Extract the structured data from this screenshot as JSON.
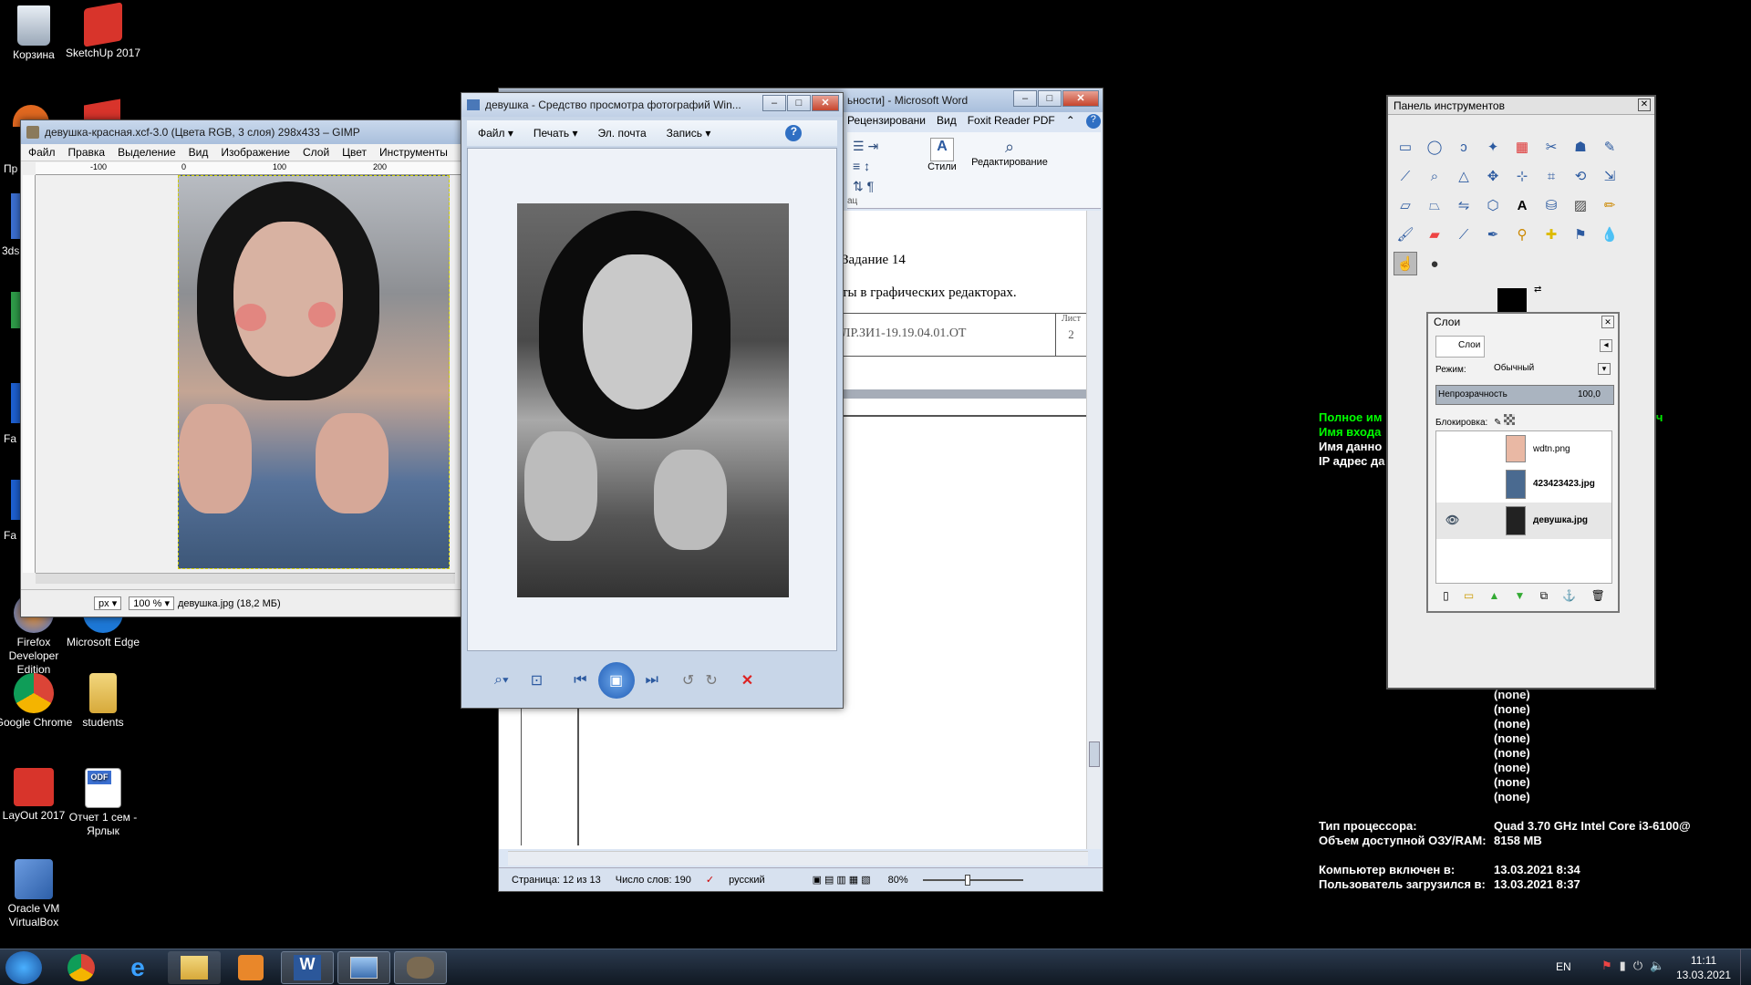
{
  "desktop": {
    "icons": [
      {
        "label": "Корзина",
        "icon": "recycle-bin-icon",
        "color": "#b8c4d0"
      },
      {
        "label": "SketchUp 2017",
        "icon": "sketchup-icon",
        "color": "#d8342b"
      },
      {
        "label": "Firefox Developer Edition",
        "icon": "firefox-icon",
        "color": "#3b6fd0"
      },
      {
        "label": "Microsoft Edge",
        "icon": "edge-icon",
        "color": "#1d78d6"
      },
      {
        "label": "Google Chrome",
        "icon": "chrome-icon",
        "color": "#2e9b48"
      },
      {
        "label": "students",
        "icon": "folder-icon",
        "color": "#e3c164"
      },
      {
        "label": "LayOut 2017",
        "icon": "layout-icon",
        "color": "#d8342b"
      },
      {
        "label": "Отчет 1 сем - Ярлык",
        "icon": "odf-document-icon",
        "color": "#3b6fd0"
      },
      {
        "label": "Oracle VM VirtualBox",
        "icon": "virtualbox-icon",
        "color": "#2d5fa8"
      }
    ],
    "partial_labels": [
      "Пр",
      "3ds",
      "Fa",
      "Fa"
    ]
  },
  "gimp": {
    "title": "девушка-красная.xcf-3.0 (Цвета RGB, 3 слоя) 298x433 – GIMP",
    "menu": [
      "Файл",
      "Правка",
      "Выделение",
      "Вид",
      "Изображение",
      "Слой",
      "Цвет",
      "Инструменты"
    ],
    "ruler": [
      "-100",
      "0",
      "100",
      "200"
    ],
    "unit": "px",
    "zoom": "100 %",
    "status": "девушка.jpg (18,2 МБ)"
  },
  "photo_viewer": {
    "title": "девушка - Средство просмотра фотографий Win...",
    "menu": [
      "Файл",
      "Печать",
      "Эл. почта",
      "Запись"
    ],
    "help": "?"
  },
  "word": {
    "title": "ьности] - Microsoft Word",
    "tabs": [
      "Рецензировани",
      "Вид",
      "Foxit Reader PDF"
    ],
    "ribbon": {
      "styles": "Стили",
      "editing": "Редактирование",
      "group": "ац"
    },
    "doc": {
      "line1": "Задание 14",
      "line2": "ты в графических редакторах.",
      "code": "ЛР.ЗИ1-19.19.04.01.ОТ",
      "sheet_label": "Лист",
      "sheet_num": "2"
    },
    "status": {
      "page": "Страница: 12 из 13",
      "words": "Число слов: 190",
      "lang": "русский",
      "zoom": "80%"
    }
  },
  "toolbox": {
    "title": "Панель инструментов",
    "layers": {
      "title": "Слои",
      "tab": "Слои",
      "mode_label": "Режим:",
      "mode_value": "Обычный",
      "opacity_label": "Непрозрачность",
      "opacity_value": "100,0",
      "lock_label": "Блокировка:",
      "items": [
        {
          "name": "wdtn.png",
          "visible": false,
          "color": "#e9b8a4"
        },
        {
          "name": "423423423.jpg",
          "visible": false,
          "color": "#4a6a90"
        },
        {
          "name": "девушка.jpg",
          "visible": true,
          "color": "#222"
        }
      ]
    }
  },
  "sysinfo": {
    "green": [
      "Полное им",
      "Имя входа"
    ],
    "green_right": "ирович",
    "white": [
      "Имя данно",
      "IP адрес да"
    ],
    "nones": [
      "(none)",
      "(none)",
      "(none)",
      "(none)",
      "(none)",
      "(none)",
      "(none)",
      "(none)"
    ],
    "rows": [
      {
        "label": "Тип процессора:",
        "value": "Quad 3.70 GHz Intel Core i3-6100@"
      },
      {
        "label": "Объем доступной ОЗУ/RAM:",
        "value": "8158 MB"
      },
      {
        "label": "Компьютер включен в:",
        "value": "13.03.2021 8:34"
      },
      {
        "label": "Пользователь загрузился в:",
        "value": "13.03.2021 8:37"
      }
    ]
  },
  "taskbar": {
    "lang": "EN",
    "time": "11:11",
    "date": "13.03.2021"
  }
}
